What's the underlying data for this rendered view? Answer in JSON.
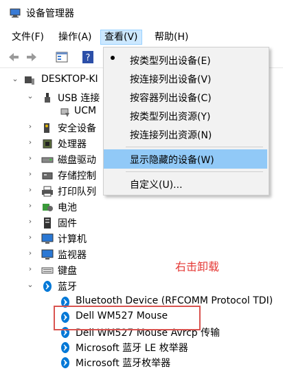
{
  "window": {
    "title": "设备管理器"
  },
  "menu": {
    "file": "文件(F)",
    "action": "操作(A)",
    "view": "查看(V)",
    "help": "帮助(H)"
  },
  "tree": {
    "root": "DESKTOP-KI",
    "usb": "USB 连接",
    "ucm": "UCM",
    "security": "安全设备",
    "processor": "处理器",
    "disk": "磁盘驱动",
    "storage": "存储控制",
    "print": "打印队列",
    "battery": "电池",
    "firmware": "固件",
    "computer": "计算机",
    "monitor": "监视器",
    "keyboard": "键盘",
    "bluetooth": "蓝牙",
    "bt_items": [
      "Bluetooth Device (RFCOMM Protocol TDI)",
      "Dell WM527 Mouse",
      "Dell WM527 Mouse Avrcp 传输",
      "Microsoft 蓝牙 LE 枚举器",
      "Microsoft 蓝牙枚举器"
    ]
  },
  "view_menu": {
    "items": [
      "按类型列出设备(E)",
      "按连接列出设备(V)",
      "按容器列出设备(C)",
      "按类型列出资源(Y)",
      "按连接列出资源(N)",
      "显示隐藏的设备(W)",
      "自定义(U)..."
    ]
  },
  "annotation": {
    "text": "右击卸载",
    "color": "#e53935"
  },
  "colors": {
    "menu_highlight": "#91c9f7",
    "bluetooth": "#0078d7"
  }
}
